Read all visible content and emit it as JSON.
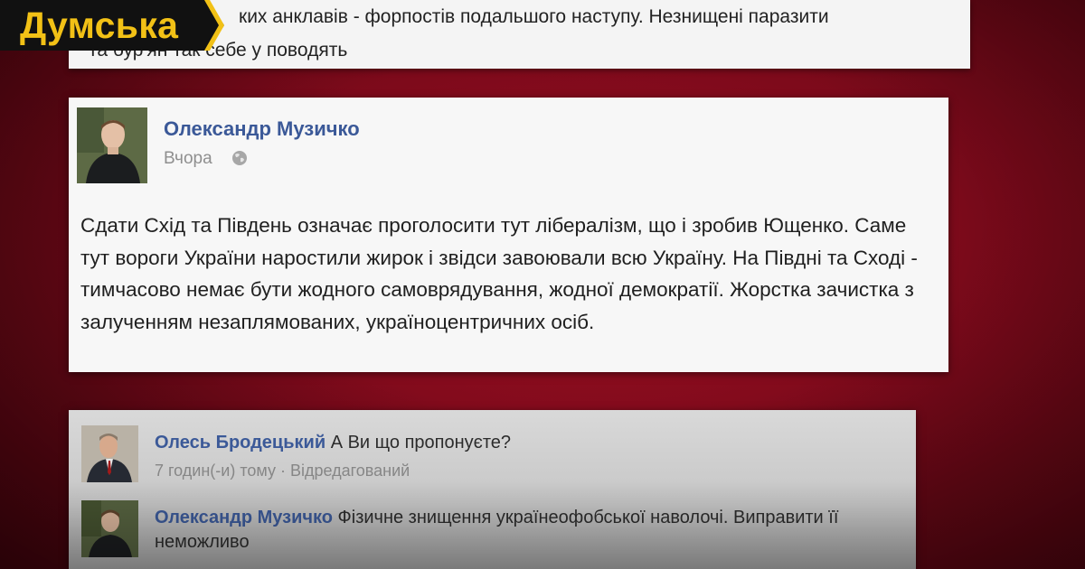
{
  "brand": {
    "name": "Думська",
    "bg_color": "#111111",
    "text_color": "#f2c116"
  },
  "top_post": {
    "line1": "ких анклавів - форпостів подальшого наступу. Незнищені паразити",
    "line2": "та бур'ян так себе у поводять"
  },
  "main_post": {
    "author": "Олександр Музичко",
    "time": "Вчора",
    "body": "Сдати Схід та Південь означає проголосити тут лібералізм, що і зробив Ющенко. Саме тут вороги України наростили жирок і звідси завоювали всю Україну. На Півдні та Сході - тимчасово немає бути жодного самоврядування, жодної демократії. Жорстка зачистка з залученням незаплямованих, україноцентричних осіб."
  },
  "comments": [
    {
      "author": "Олесь Бродецький",
      "text": "А Ви що пропонуєте?",
      "meta": "7 годин(-и) тому · Відредагований"
    },
    {
      "author": "Олександр Музичко",
      "text": "Фізичне знищення українеофобської наволочі. Виправити її неможливо",
      "meta": ""
    }
  ],
  "colors": {
    "link": "#3b5998",
    "background": "#8a0c1f"
  }
}
